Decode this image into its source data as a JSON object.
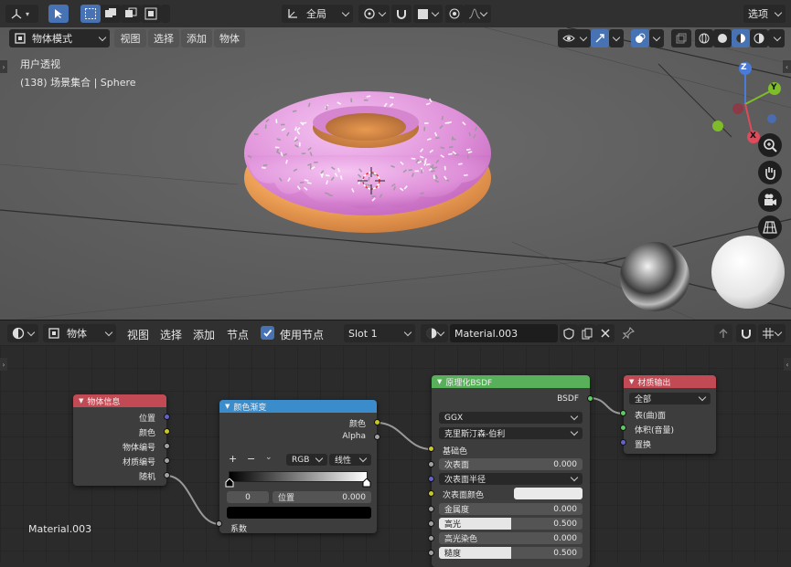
{
  "viewport_header": {
    "options_label": "选项",
    "transform_orientation": "全局",
    "mode_label": "物体模式",
    "menus": [
      "视图",
      "选择",
      "添加",
      "物体"
    ]
  },
  "viewport": {
    "view_name": "用户透视",
    "object_info": "(138) 场景集合 | Sphere",
    "gizmo": {
      "z": "Z",
      "y": "Y",
      "x": "X"
    }
  },
  "node_header": {
    "editor_type": "物体",
    "menus": [
      "视图",
      "选择",
      "添加",
      "节点"
    ],
    "use_nodes_label": "使用节点",
    "use_nodes_checked": true,
    "slot": "Slot 1",
    "material_name": "Material.003"
  },
  "material_label": "Material.003",
  "nodes": {
    "object_info": {
      "title": "物体信息",
      "outputs": [
        "位置",
        "颜色",
        "物体编号",
        "材质编号",
        "随机"
      ]
    },
    "color_ramp": {
      "title": "颜色渐变",
      "outputs": [
        "颜色",
        "Alpha"
      ],
      "mode": "RGB",
      "interpolation": "线性",
      "plus": "+",
      "minus": "−",
      "stop_index": "0",
      "position_label": "位置",
      "position_value": "0.000",
      "input_label": "系数"
    },
    "bsdf": {
      "title": "原理化BSDF",
      "output": "BSDF",
      "distribution": "GGX",
      "subsurface_method": "克里斯汀森-伯利",
      "base_color_label": "基础色",
      "subsurface_label": "次表面",
      "subsurface_value": "0.000",
      "subsurface_radius_label": "次表面半径",
      "subsurface_color_label": "次表面颜色",
      "metallic_label": "金属度",
      "metallic_value": "0.000",
      "specular_label": "高光",
      "specular_value": "0.500",
      "specular_tint_label": "高光染色",
      "specular_tint_value": "0.000",
      "roughness_label": "糙度",
      "roughness_value": "0.500",
      "specular_fill": 0.5,
      "roughness_fill": 0.5
    },
    "material_output": {
      "title": "材质输出",
      "target": "全部",
      "inputs": [
        "表(曲)面",
        "体积(音量)",
        "置换"
      ]
    }
  },
  "colors": {
    "accent": "#4772b3",
    "object_info_header": "#c24a55",
    "color_ramp_header": "#3b8ccb",
    "bsdf_header": "#58b05a",
    "output_header": "#c24a55"
  }
}
